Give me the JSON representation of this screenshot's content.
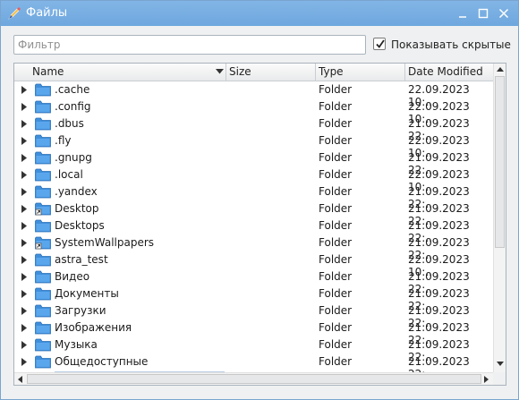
{
  "window": {
    "title": "Файлы",
    "icon": "pen-brush-icon"
  },
  "controls": {
    "minimize": "minimize-icon",
    "maximize": "maximize-icon",
    "close": "close-icon"
  },
  "filter": {
    "placeholder": "Фильтр",
    "value": ""
  },
  "show_hidden": {
    "label": "Показывать скрытые",
    "checked": true
  },
  "columns": {
    "name": "Name",
    "size": "Size",
    "type": "Type",
    "date": "Date Modified"
  },
  "sort": {
    "column": "Name",
    "direction": "descending"
  },
  "rows": [
    {
      "name": ".cache",
      "type": "Folder",
      "date": "22.09.2023 10:..",
      "icon": "folder-icon"
    },
    {
      "name": ".config",
      "type": "Folder",
      "date": "22.09.2023 10:..",
      "icon": "folder-icon"
    },
    {
      "name": ".dbus",
      "type": "Folder",
      "date": "21.09.2023 22:..",
      "icon": "folder-icon"
    },
    {
      "name": ".fly",
      "type": "Folder",
      "date": "22.09.2023 10:..",
      "icon": "folder-icon"
    },
    {
      "name": ".gnupg",
      "type": "Folder",
      "date": "21.09.2023 22:..",
      "icon": "folder-icon"
    },
    {
      "name": ".local",
      "type": "Folder",
      "date": "22.09.2023 10:..",
      "icon": "folder-icon"
    },
    {
      "name": ".yandex",
      "type": "Folder",
      "date": "21.09.2023 22:..",
      "icon": "folder-icon"
    },
    {
      "name": "Desktop",
      "type": "Folder",
      "date": "21.09.2023 22:..",
      "icon": "folder-link-icon"
    },
    {
      "name": "Desktops",
      "type": "Folder",
      "date": "21.09.2023 22:..",
      "icon": "folder-icon"
    },
    {
      "name": "SystemWallpapers",
      "type": "Folder",
      "date": "21.09.2023 22:..",
      "icon": "folder-link-icon"
    },
    {
      "name": "astra_test",
      "type": "Folder",
      "date": "22.09.2023 10:..",
      "icon": "folder-icon"
    },
    {
      "name": "Видео",
      "type": "Folder",
      "date": "21.09.2023 22:..",
      "icon": "folder-icon"
    },
    {
      "name": "Документы",
      "type": "Folder",
      "date": "21.09.2023 22:..",
      "icon": "folder-icon"
    },
    {
      "name": "Загрузки",
      "type": "Folder",
      "date": "21.09.2023 22:..",
      "icon": "folder-icon"
    },
    {
      "name": "Изображения",
      "type": "Folder",
      "date": "21.09.2023 22:..",
      "icon": "folder-icon"
    },
    {
      "name": "Музыка",
      "type": "Folder",
      "date": "21.09.2023 22:..",
      "icon": "folder-icon"
    },
    {
      "name": "Общедоступные",
      "type": "Folder",
      "date": "21.09.2023 22:..",
      "icon": "folder-icon"
    }
  ],
  "colors": {
    "titlebar": "#6ea7de",
    "folder": "#3f8fdc",
    "background": "#eff0f1"
  }
}
